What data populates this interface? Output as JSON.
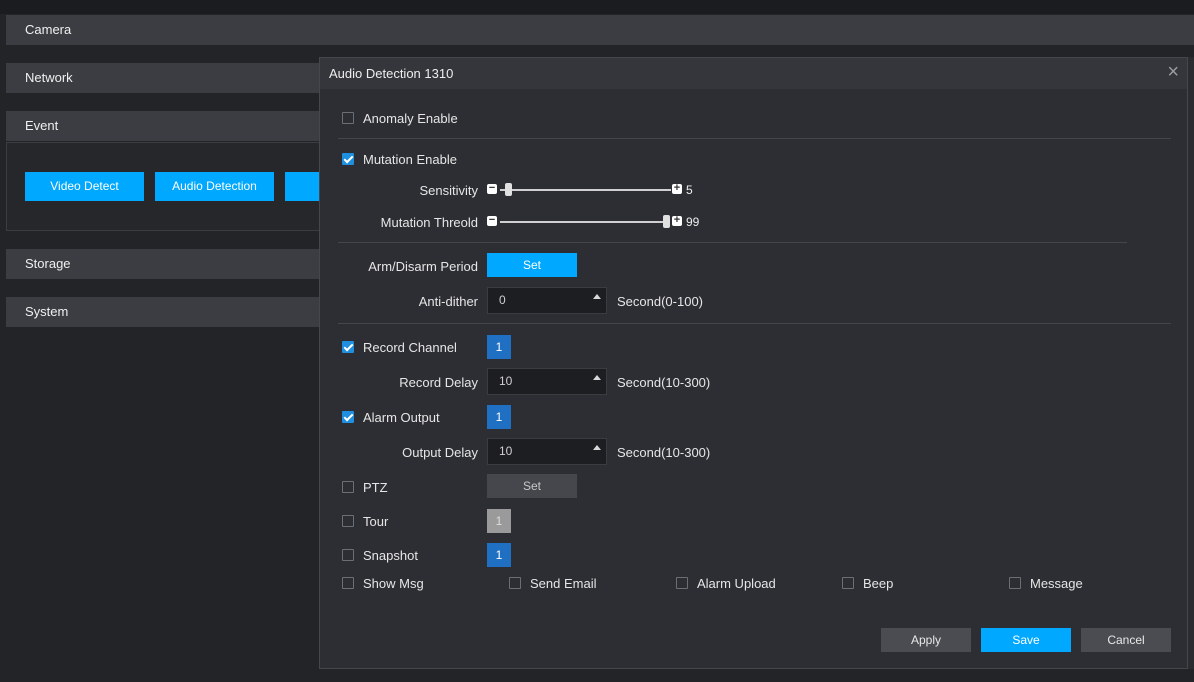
{
  "sidebar": {
    "sections": [
      "Camera",
      "Network",
      "Event",
      "Storage",
      "System"
    ],
    "event_buttons": [
      "Video Detect",
      "Audio Detection"
    ]
  },
  "dialog": {
    "title": "Audio Detection 1310",
    "anomaly_enable": {
      "label": "Anomaly Enable",
      "checked": false
    },
    "mutation_enable": {
      "label": "Mutation Enable",
      "checked": true
    },
    "sensitivity": {
      "label": "Sensitivity",
      "value": "5",
      "minus": "−",
      "plus": "+"
    },
    "mutation_threshold": {
      "label": "Mutation Threold",
      "value": "99",
      "minus": "−",
      "plus": "+"
    },
    "arm_disarm": {
      "label": "Arm/Disarm Period",
      "button": "Set"
    },
    "anti_dither": {
      "label": "Anti-dither",
      "value": "0",
      "unit": "Second(0-100)"
    },
    "record_channel": {
      "label": "Record Channel",
      "checked": true,
      "channel": "1"
    },
    "record_delay": {
      "label": "Record Delay",
      "value": "10",
      "unit": "Second(10-300)"
    },
    "alarm_output": {
      "label": "Alarm Output",
      "checked": true,
      "channel": "1"
    },
    "output_delay": {
      "label": "Output Delay",
      "value": "10",
      "unit": "Second(10-300)"
    },
    "ptz": {
      "label": "PTZ",
      "checked": false,
      "button": "Set"
    },
    "tour": {
      "label": "Tour",
      "checked": false,
      "channel": "1"
    },
    "snapshot": {
      "label": "Snapshot",
      "checked": false,
      "channel": "1"
    },
    "bottom_options": [
      "Show Msg",
      "Send Email",
      "Alarm Upload",
      "Beep",
      "Message"
    ],
    "footer": {
      "apply": "Apply",
      "save": "Save",
      "cancel": "Cancel"
    }
  },
  "colors": {
    "accent": "#00a8ff",
    "channel_blue": "#1f6fc2",
    "background": "#222428"
  }
}
